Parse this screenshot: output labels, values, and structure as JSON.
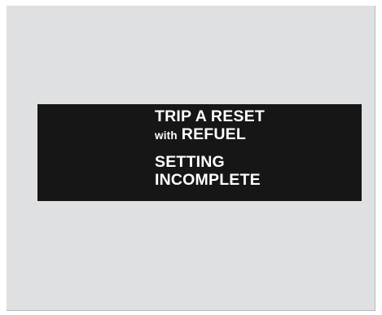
{
  "display": {
    "line1": "TRIP A RESET",
    "line2_prefix": "with",
    "line2_main": "REFUEL",
    "line3": "SETTING",
    "line4": "INCOMPLETE"
  },
  "colors": {
    "background_panel": "#dfe0e2",
    "display_bg": "#161616",
    "text": "#ffffff"
  }
}
